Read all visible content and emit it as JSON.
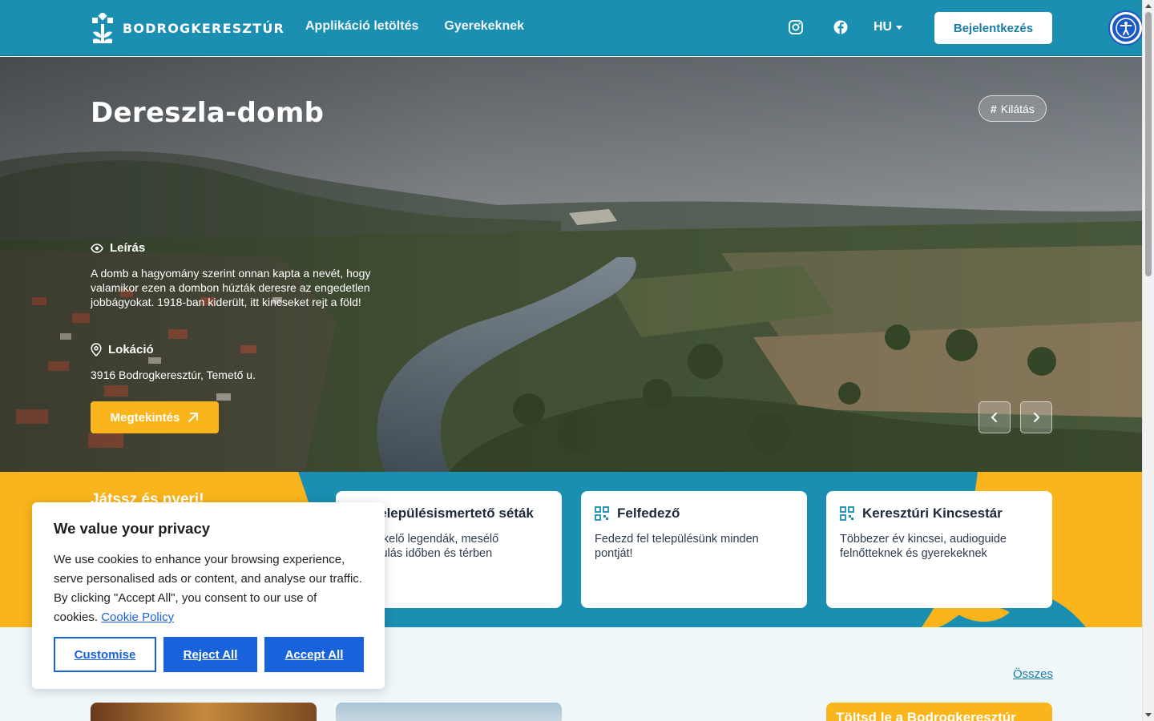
{
  "header": {
    "logo_text": "BODROGKERESZTÚR",
    "nav": [
      "Applikáció letöltés",
      "Gyerekeknek"
    ],
    "social_icons": [
      "instagram-icon",
      "facebook-icon"
    ],
    "language": "HU",
    "login_label": "Bejelentkezés",
    "accessibility_icon": "accessibility-icon"
  },
  "hero": {
    "title": "Dereszla-domb",
    "tag": "Kilátás",
    "description_label": "Leírás",
    "description_text": "A domb a hagyomány szerint onnan kapta a nevét, hogy valamikor ezen a dombon húzták deresre az engedetlen jobbágyokat. 1918-ban kiderült, itt kincseket rejt a föld!",
    "location_label": "Lokáció",
    "location_text": "3916 Bodrogkeresztúr, Temető u.",
    "view_button": "Megtekintés"
  },
  "band": {
    "title": "Játssz és nyerj!",
    "cards": [
      {
        "title": "Településismertető séták",
        "text": "Életre kelő legendák, mesélő kirándulás időben és térben"
      },
      {
        "title": "Felfedező",
        "text": "Fedezd fel településünk minden pontját!"
      },
      {
        "title": "Keresztúri Kincsestár",
        "text": "Többezer év kincsei, audioguide felnőtteknek és gyerekeknek"
      }
    ]
  },
  "listing": {
    "all_link": "Összes",
    "promo_text": "Töltsd le a Bodrogkeresztúr"
  },
  "cookie": {
    "title": "We value your privacy",
    "text": "We use cookies to enhance your browsing experience, serve personalised ads or content, and analyse our traffic. By clicking \"Accept All\", you consent to our use of cookies.",
    "policy_link": "Cookie Policy",
    "customise": "Customise",
    "reject": "Reject All",
    "accept": "Accept All"
  },
  "colors": {
    "primary": "#1a8fb2",
    "accent": "#f9b51b",
    "cookie_blue": "#1863dc"
  }
}
